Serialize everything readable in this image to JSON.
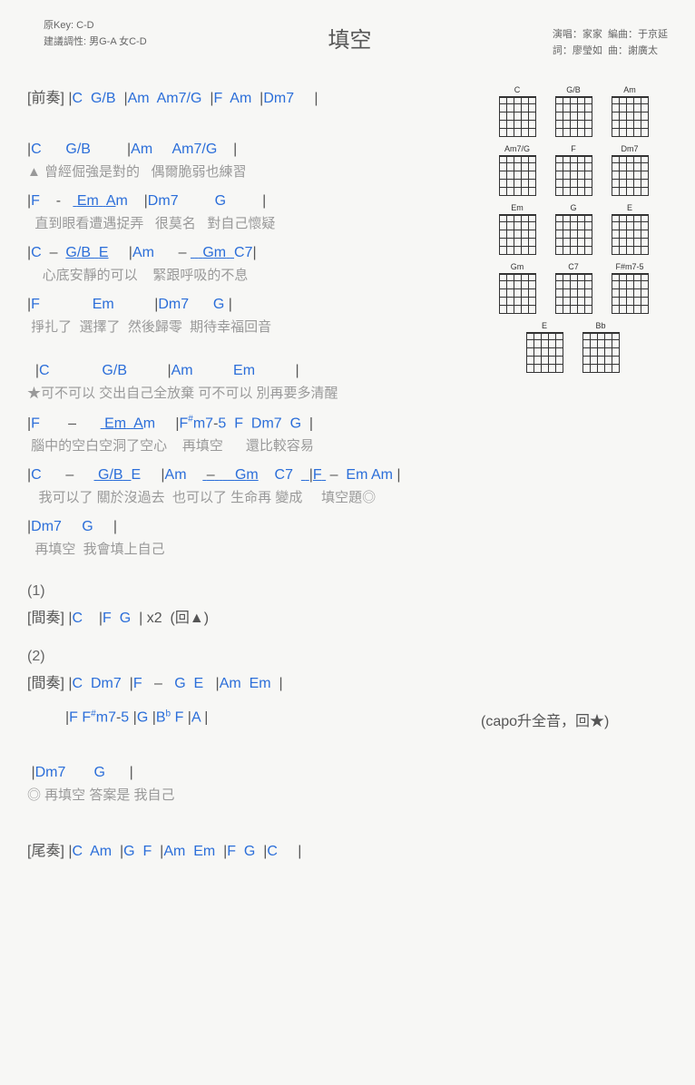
{
  "header": {
    "title": "填空",
    "key_label": "原Key: C-D",
    "tuning_label": "建議調性: 男G-A 女C-D",
    "singer_label": "演唱：家家",
    "arranger_label": "編曲：于京延",
    "lyricist_label": "詞：廖瑩如",
    "composer_label": "曲：謝廣太"
  },
  "diagrams": [
    [
      "C",
      "G/B",
      "Am"
    ],
    [
      "Am7/G",
      "F",
      "Dm7"
    ],
    [
      "Em",
      "G",
      "E"
    ],
    [
      "Gm",
      "C7",
      "F#m7-5"
    ],
    [
      "E",
      "Bb"
    ]
  ],
  "intro": {
    "label": "[前奏]",
    "chords": " |C  G/B  |Am  Am7/G  |F  Am  |Dm7     |"
  },
  "verse": [
    {
      "chords": "|C      G/B         |Am     Am7/G    |",
      "lyrics": "▲ 曾經倔強是對的   偶爾脆弱也練習"
    },
    {
      "chords": "|F    -    Em  Am    |Dm7         G         |",
      "lyrics": "  直到眼看遭遇捉弄   很莫名   對自己懷疑",
      "u": [
        10,
        16
      ]
    },
    {
      "chords": "|C  –  G/B  E     |Am      –    Gm  C7|",
      "lyrics": "    心底安靜的可以    緊跟呼吸的不息",
      "u1": [
        7,
        13
      ],
      "u2": [
        29,
        36
      ]
    },
    {
      "chords": "|F             Em          |Dm7      G |",
      "lyrics": " 掙扎了  選擇了  然後歸零  期待幸福回音"
    }
  ],
  "chorus": [
    {
      "chords": "  |C             G/B          |Am          Em          |",
      "lyrics": "★可不可以 交出自己全放棄 可不可以 別再要多清醒"
    },
    {
      "chords": "|F       –       Em  Am     |F#m7-5  F  Dm7  G  |",
      "lyrics": " 腦中的空白空洞了空心    再填空      還比較容易",
      "u": [
        16,
        22
      ]
    },
    {
      "chords": "|C      –      G/B  E     |Am     –     Gm    C7    |F  –  Em Am |",
      "lyrics": "   我可以了 關於沒過去  也可以了 生命再 變成     填空題◎",
      "u1": [
        14,
        20
      ],
      "u2": [
        33,
        42
      ],
      "u3": [
        50,
        55
      ]
    },
    {
      "chords": "|Dm7     G     |",
      "lyrics": "  再填空  我會填上自己"
    }
  ],
  "inter1": {
    "num": "(1)",
    "label": "[間奏]",
    "chords": " |C    |F  G  | x2  (回▲)"
  },
  "inter2": {
    "num": "(2)",
    "label": "[間奏]",
    "chords1": " |C  Dm7  |F   –   G  E   |Am  Em  |",
    "chords2": " |F  F#m7-5   |G     |Bb  F  |A    |",
    "note": "(capo升全音，回★)"
  },
  "coda": {
    "chords": " |Dm7       G      |",
    "lyrics": "◎ 再填空 答案是 我自己"
  },
  "outro": {
    "label": "[尾奏]",
    "chords": " |C  Am  |G  F  |Am  Em  |F  G  |C     |"
  }
}
